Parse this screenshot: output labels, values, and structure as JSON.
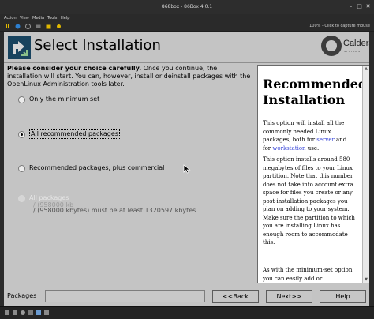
{
  "window": {
    "title": "868box - 86Box 4.0.1"
  },
  "menubar": [
    "Action",
    "View",
    "Media",
    "Tools",
    "Help"
  ],
  "status": {
    "capture_hint": "100% - Click to capture mouse"
  },
  "header": {
    "title": "Select Installation",
    "logo_text": "Caldera",
    "logo_sub": "SYSTEMS"
  },
  "intro": {
    "bold": "Please consider your choice carefully.",
    "text": " Once you continue, the installation will start. You can, however, install or deinstall packages with the OpenLinux Administration tools later."
  },
  "options": [
    {
      "label": "Only the minimum set",
      "selected": false,
      "disabled": false
    },
    {
      "label": "All recommended packages",
      "selected": true,
      "disabled": false
    },
    {
      "label": "Recommended packages, plus commercial",
      "selected": false,
      "disabled": false
    },
    {
      "label": "All packages",
      "selected": false,
      "disabled": true
    }
  ],
  "disabled_note": {
    "line1": "/ (958000 kb",
    "line2": "/ (958000 kbytes) must be at least 1320597 kbytes"
  },
  "help": {
    "heading": "Recommended Installation",
    "p1_a": "This option will install all the commonly needed Linux packages, both for ",
    "p1_link1": "server",
    "p1_b": " and for ",
    "p1_link2": "workstation",
    "p1_c": " use.",
    "p2": "This option installs around 580 megabytes of files to your Linux partition. Note that this number does not take into account extra space for files you create or any post-installation packages you plan on adding to your system. Make sure the partition to which you are installing Linux has enough room to accommodate this.",
    "p3": "As with the minimum-set option, you can easily add or"
  },
  "bottom": {
    "packages_label": "Packages",
    "back": "<<Back",
    "next": "Next>>",
    "help": "Help"
  },
  "colors": {
    "accent": "#18435e",
    "link": "#3a48d8",
    "background": "#c4c4c4"
  }
}
